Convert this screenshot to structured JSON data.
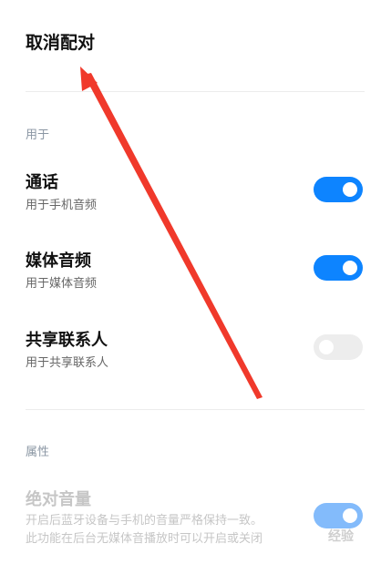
{
  "unpair_label": "取消配对",
  "sections": {
    "usage_label": "用于",
    "attributes_label": "属性"
  },
  "rows": [
    {
      "title": "通话",
      "subtitle": "用于手机音频",
      "enabled": true
    },
    {
      "title": "媒体音频",
      "subtitle": "用于媒体音频",
      "enabled": true
    },
    {
      "title": "共享联系人",
      "subtitle": "用于共享联系人",
      "enabled": false
    }
  ],
  "absolute_volume": {
    "title": "绝对音量",
    "description_line1": "开启后蓝牙设备与手机的音量严格保持一致。",
    "description_line2": "此功能在后台无媒体音播放时可以开启或关闭",
    "enabled": true,
    "disabled_state": true
  },
  "watermark": "经验",
  "colors": {
    "accent": "#0d84ff",
    "arrow": "#f0392b",
    "switch_off": "#ededed"
  }
}
